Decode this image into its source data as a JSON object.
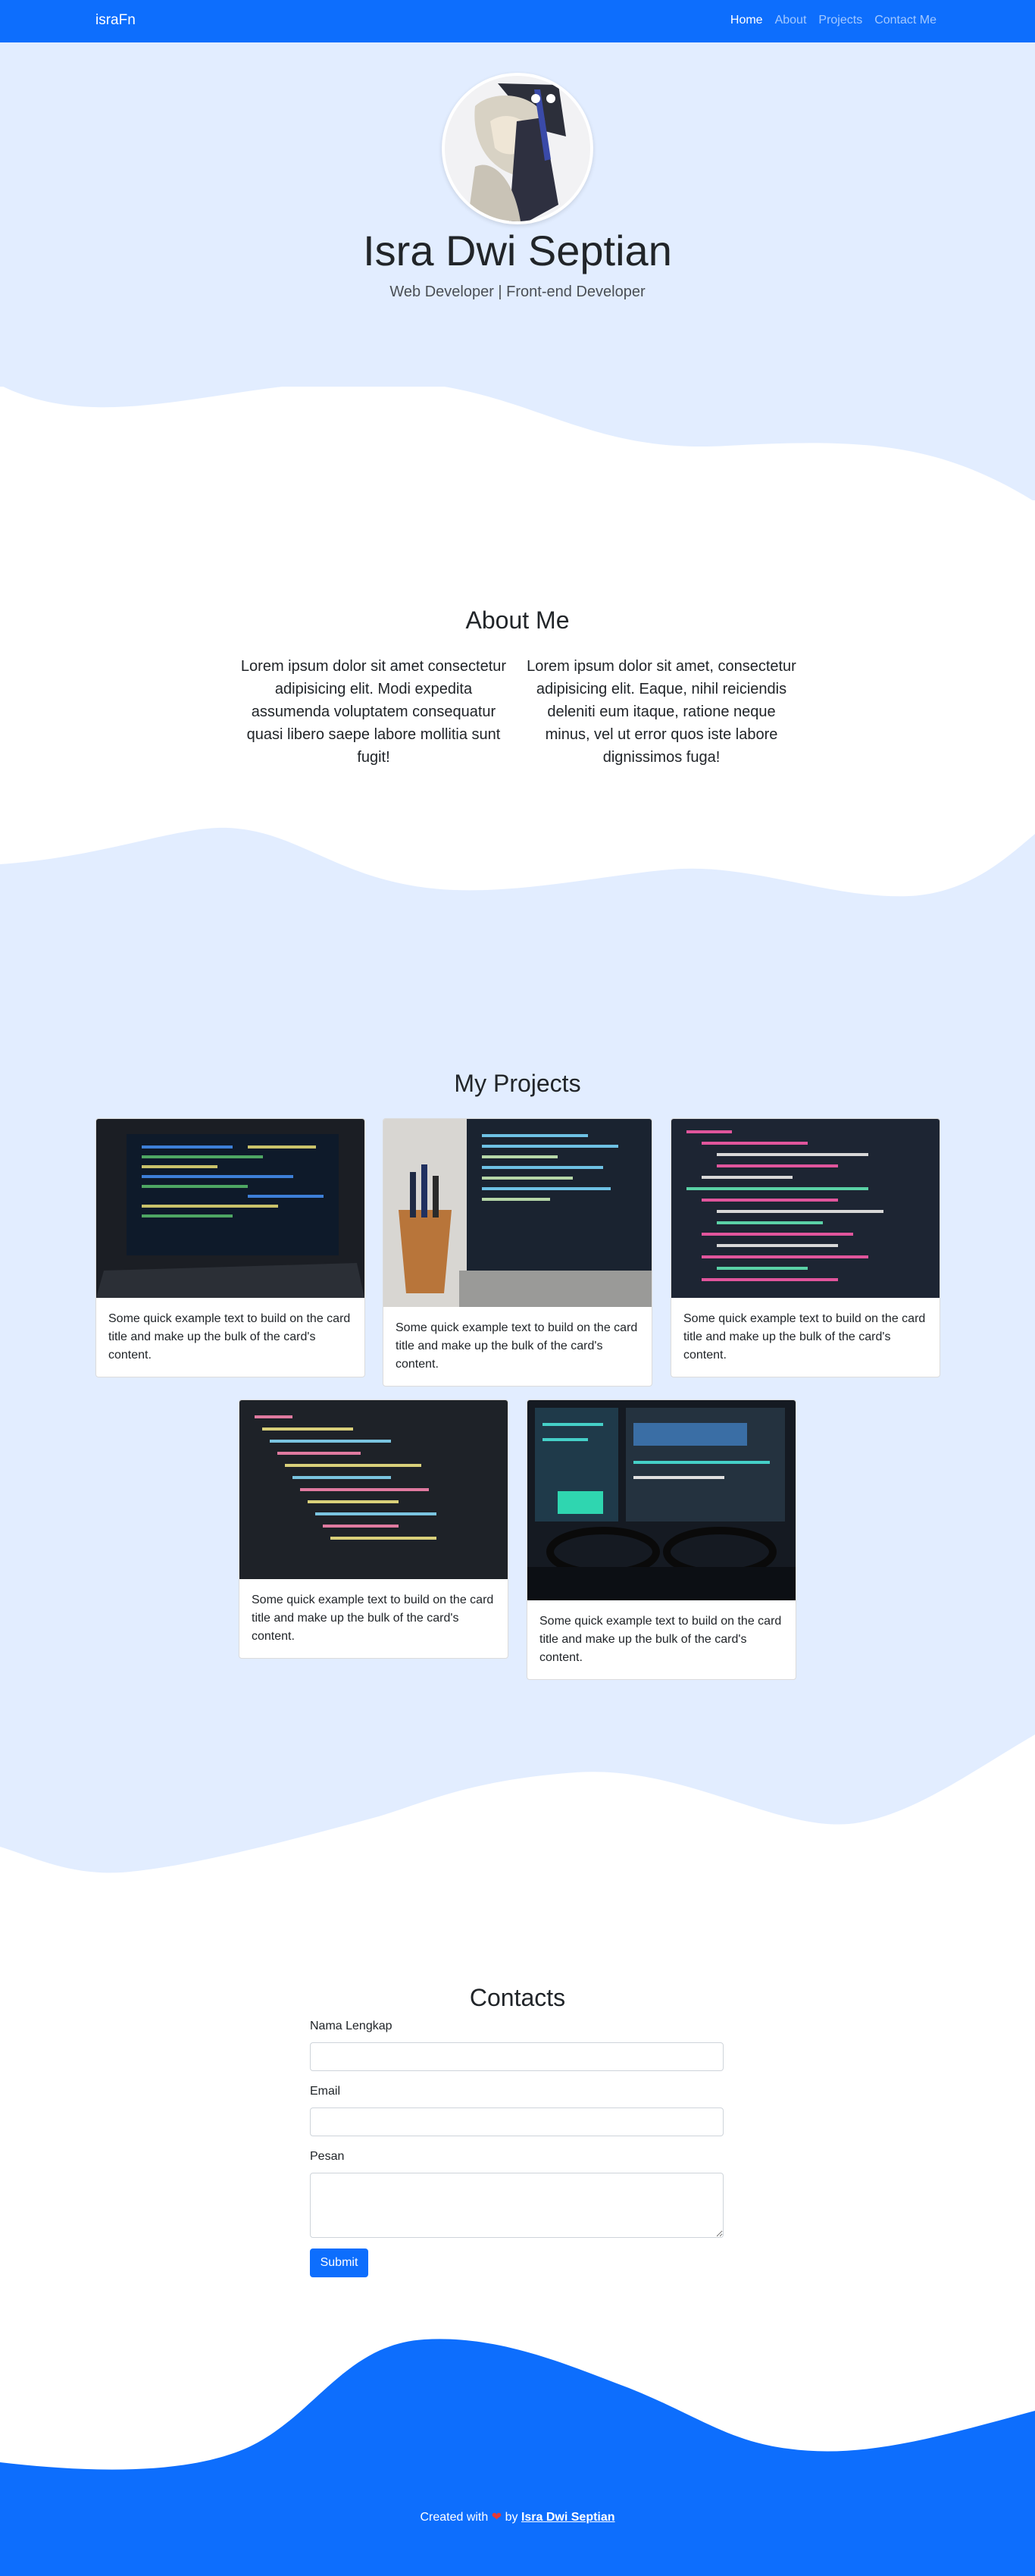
{
  "navbar": {
    "brand": "israFn",
    "links": [
      "Home",
      "About",
      "Projects",
      "Contact Me"
    ]
  },
  "hero": {
    "name": "Isra Dwi Septian",
    "subtitle": "Web Developer | Front-end Developer"
  },
  "about": {
    "title": "About Me",
    "col1": "Lorem ipsum dolor sit amet consectetur adipisicing elit. Modi expedita assumenda voluptatem consequatur quasi libero saepe labore mollitia sunt fugit!",
    "col2": "Lorem ipsum dolor sit amet, consectetur adipisicing elit. Eaque, nihil reiciendis deleniti eum itaque, ratione neque minus, vel ut error quos iste labore dignissimos fuga!"
  },
  "projects": {
    "title": "My Projects",
    "card_text": "Some quick example text to build on the card title and make up the bulk of the card's content.",
    "cards": [
      {
        "text": "Some quick example text to build on the card title and make up the bulk of the card's content."
      },
      {
        "text": "Some quick example text to build on the card title and make up the bulk of the card's content."
      },
      {
        "text": "Some quick example text to build on the card title and make up the bulk of the card's content."
      },
      {
        "text": "Some quick example text to build on the card title and make up the bulk of the card's content."
      },
      {
        "text": "Some quick example text to build on the card title and make up the bulk of the card's content."
      }
    ]
  },
  "contact": {
    "title": "Contacts",
    "name_label": "Nama Lengkap",
    "email_label": "Email",
    "message_label": "Pesan",
    "submit_label": "Submit"
  },
  "footer": {
    "prefix": "Created with",
    "heart": "❤",
    "by": "by",
    "author": "Isra Dwi Septian"
  },
  "colors": {
    "primary": "#0d6efd",
    "light_band": "#e2edff"
  }
}
